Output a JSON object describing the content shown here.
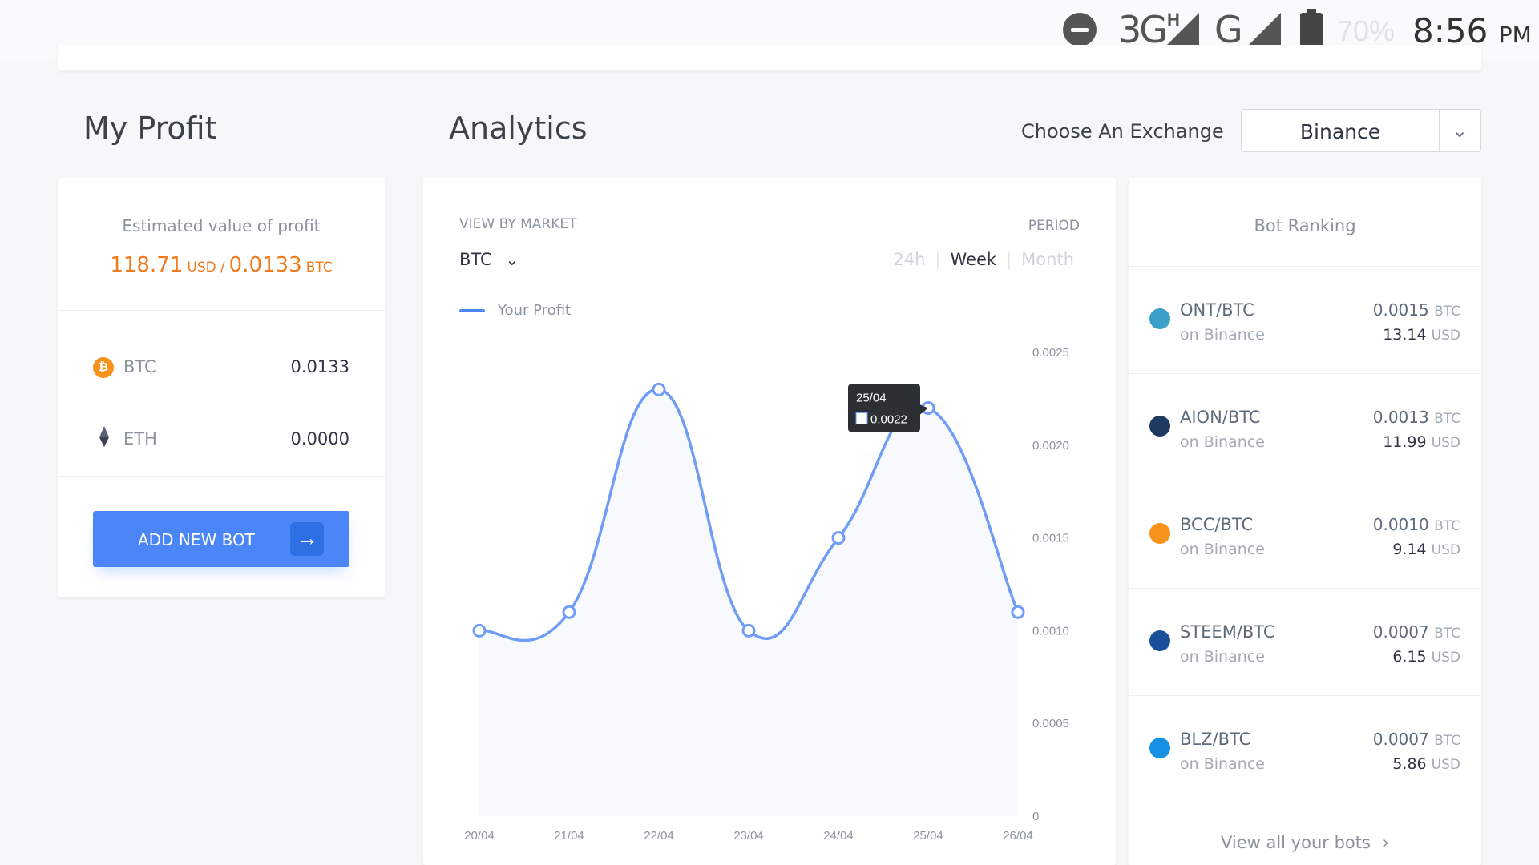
{
  "status_bar": {
    "network1": "3G",
    "network1_sup": "H",
    "network2": "G",
    "battery": "70%",
    "time": "8:56",
    "ampm": "PM"
  },
  "profit": {
    "title": "My Profit",
    "estimated_label": "Estimated value of profit",
    "usd_value": "118.71",
    "usd_unit": "USD",
    "separator": "/",
    "btc_value": "0.0133",
    "btc_unit": "BTC",
    "coins": [
      {
        "name": "BTC",
        "value": "0.0133",
        "icon": "bitcoin-icon"
      },
      {
        "name": "ETH",
        "value": "0.0000",
        "icon": "ethereum-icon"
      }
    ],
    "add_bot_label": "ADD NEW BOT"
  },
  "analytics": {
    "title": "Analytics",
    "exchange_label": "Choose An Exchange",
    "exchange_value": "Binance",
    "view_by_label": "VIEW BY MARKET",
    "market_value": "BTC",
    "period_label": "PERIOD",
    "period_tabs": [
      "24h",
      "Week",
      "Month"
    ],
    "active_period": "Week",
    "tooltip_date": "25/04",
    "tooltip_value": "0.0022"
  },
  "chart_data": {
    "type": "line",
    "x": [
      "20/04",
      "21/04",
      "22/04",
      "23/04",
      "24/04",
      "25/04",
      "26/04"
    ],
    "series": [
      {
        "name": "Your Profit",
        "values": [
          0.001,
          0.0011,
          0.0023,
          0.001,
          0.0015,
          0.0022,
          0.0011
        ]
      }
    ],
    "yticks": [
      "0.0025",
      "0.0020",
      "0.0015",
      "0.0010",
      "0.0005",
      "0"
    ],
    "ylim": [
      0,
      0.0025
    ],
    "color": "#6f9cf6",
    "area_fill": true,
    "legend": "top-left"
  },
  "ranking": {
    "title": "Bot Ranking",
    "bots": [
      {
        "pair": "ONT/BTC",
        "exchange": "on Binance",
        "btc": "0.0015",
        "usd": "13.14",
        "icon": "ontology-icon",
        "color": "#3aa0c9"
      },
      {
        "pair": "AION/BTC",
        "exchange": "on Binance",
        "btc": "0.0013",
        "usd": "11.99",
        "icon": "aion-icon",
        "color": "#1e3a5f"
      },
      {
        "pair": "BCC/BTC",
        "exchange": "on Binance",
        "btc": "0.0010",
        "usd": "9.14",
        "icon": "bitcoin-cash-icon",
        "color": "#f7931a"
      },
      {
        "pair": "STEEM/BTC",
        "exchange": "on Binance",
        "btc": "0.0007",
        "usd": "6.15",
        "icon": "steem-icon",
        "color": "#1a5099"
      },
      {
        "pair": "BLZ/BTC",
        "exchange": "on Binance",
        "btc": "0.0007",
        "usd": "5.86",
        "icon": "bluzelle-icon",
        "color": "#1592e6"
      }
    ],
    "btc_unit": "BTC",
    "usd_unit": "USD",
    "view_all": "View all your bots"
  }
}
